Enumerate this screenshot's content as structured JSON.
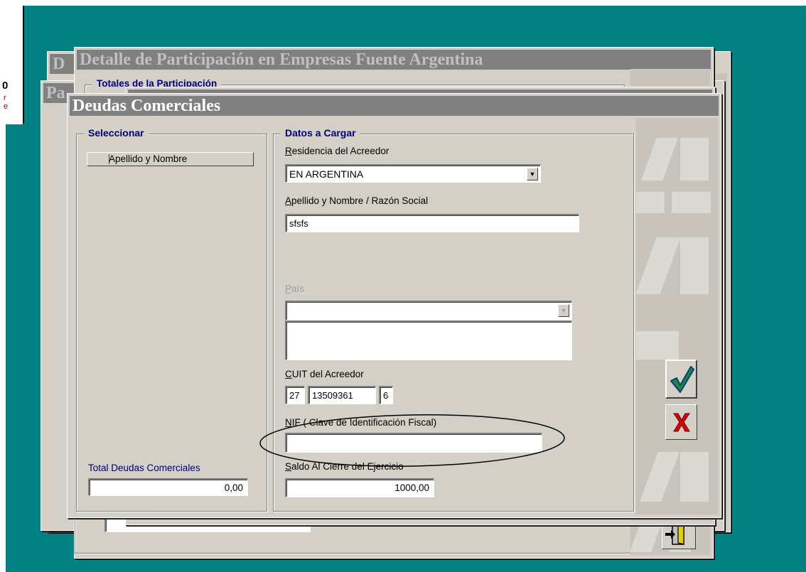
{
  "windows": {
    "back_title_letter": "D",
    "back_prefix_letters": "Pa",
    "detalle_title": "Detalle de Participación en Empresas Fuente Argentina",
    "totales_group": "Totales de la Participación",
    "main_title": "Deudas Comerciales"
  },
  "left_fragments": {
    "digit": "0",
    "red_line1": "r",
    "red_line2": "e"
  },
  "seleccionar": {
    "group_title": "Seleccionar",
    "column_header": "Apellido y Nombre",
    "total_label": "Total Deudas Comerciales",
    "total_value": "0,00"
  },
  "datos": {
    "group_title": "Datos a Cargar",
    "residencia_label_first": "R",
    "residencia_label_rest": "esidencia del Acreedor",
    "residencia_value": "EN ARGENTINA",
    "apellido_label_first": "A",
    "apellido_label_rest": "pellido y Nombre / Razón Social",
    "apellido_value": "sfsfs",
    "pais_label_first": "P",
    "pais_label_rest": "aís",
    "pais_value": "",
    "cuit_label_first": "C",
    "cuit_label_rest": "UIT del Acreedor",
    "cuit_part1": "27",
    "cuit_part2": "13509361",
    "cuit_part3": "6",
    "nif_label_first": "N",
    "nif_label_rest": "IF ( Clave de Identificación Fiscal)",
    "nif_value": "",
    "saldo_label_first": "S",
    "saldo_label_rest": "aldo Al Cierre del Ejercicio",
    "saldo_value": "1000,00"
  },
  "icons": {
    "accept": "checkmark-icon",
    "cancel": "red-x-icon",
    "exit": "door-exit-icon"
  },
  "colors": {
    "desktop": "#008080",
    "accept_check": "#1a8a2a",
    "cancel_x": "#e00000",
    "group_title": "#00007b"
  }
}
